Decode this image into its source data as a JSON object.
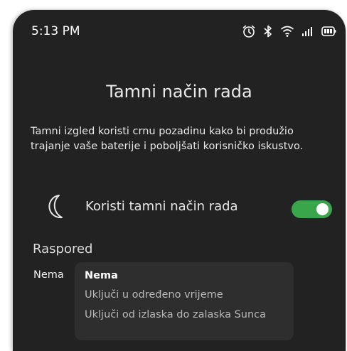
{
  "status_bar": {
    "time": "5:13 PM",
    "icons": [
      "alarm-icon",
      "bluetooth-icon",
      "wifi-icon",
      "signal-icon",
      "battery-icon"
    ]
  },
  "page": {
    "title": "Tamni način rada",
    "description": "Tamni izgled koristi crnu pozadinu kako bi produžio trajanje vaše baterije i poboljšati korisničko iskustvo."
  },
  "dark_mode": {
    "icon": "moon-icon",
    "label": "Koristi tamni način rada",
    "enabled": true,
    "accent_color": "#3aa64b"
  },
  "schedule": {
    "heading": "Raspored",
    "current_value": "Nema",
    "options": [
      {
        "label": "Nema",
        "selected": true
      },
      {
        "label": "Uključi u određeno vrijeme",
        "selected": false
      },
      {
        "label": "Uključi od izlaska do zalaska Sunca",
        "selected": false
      }
    ]
  }
}
